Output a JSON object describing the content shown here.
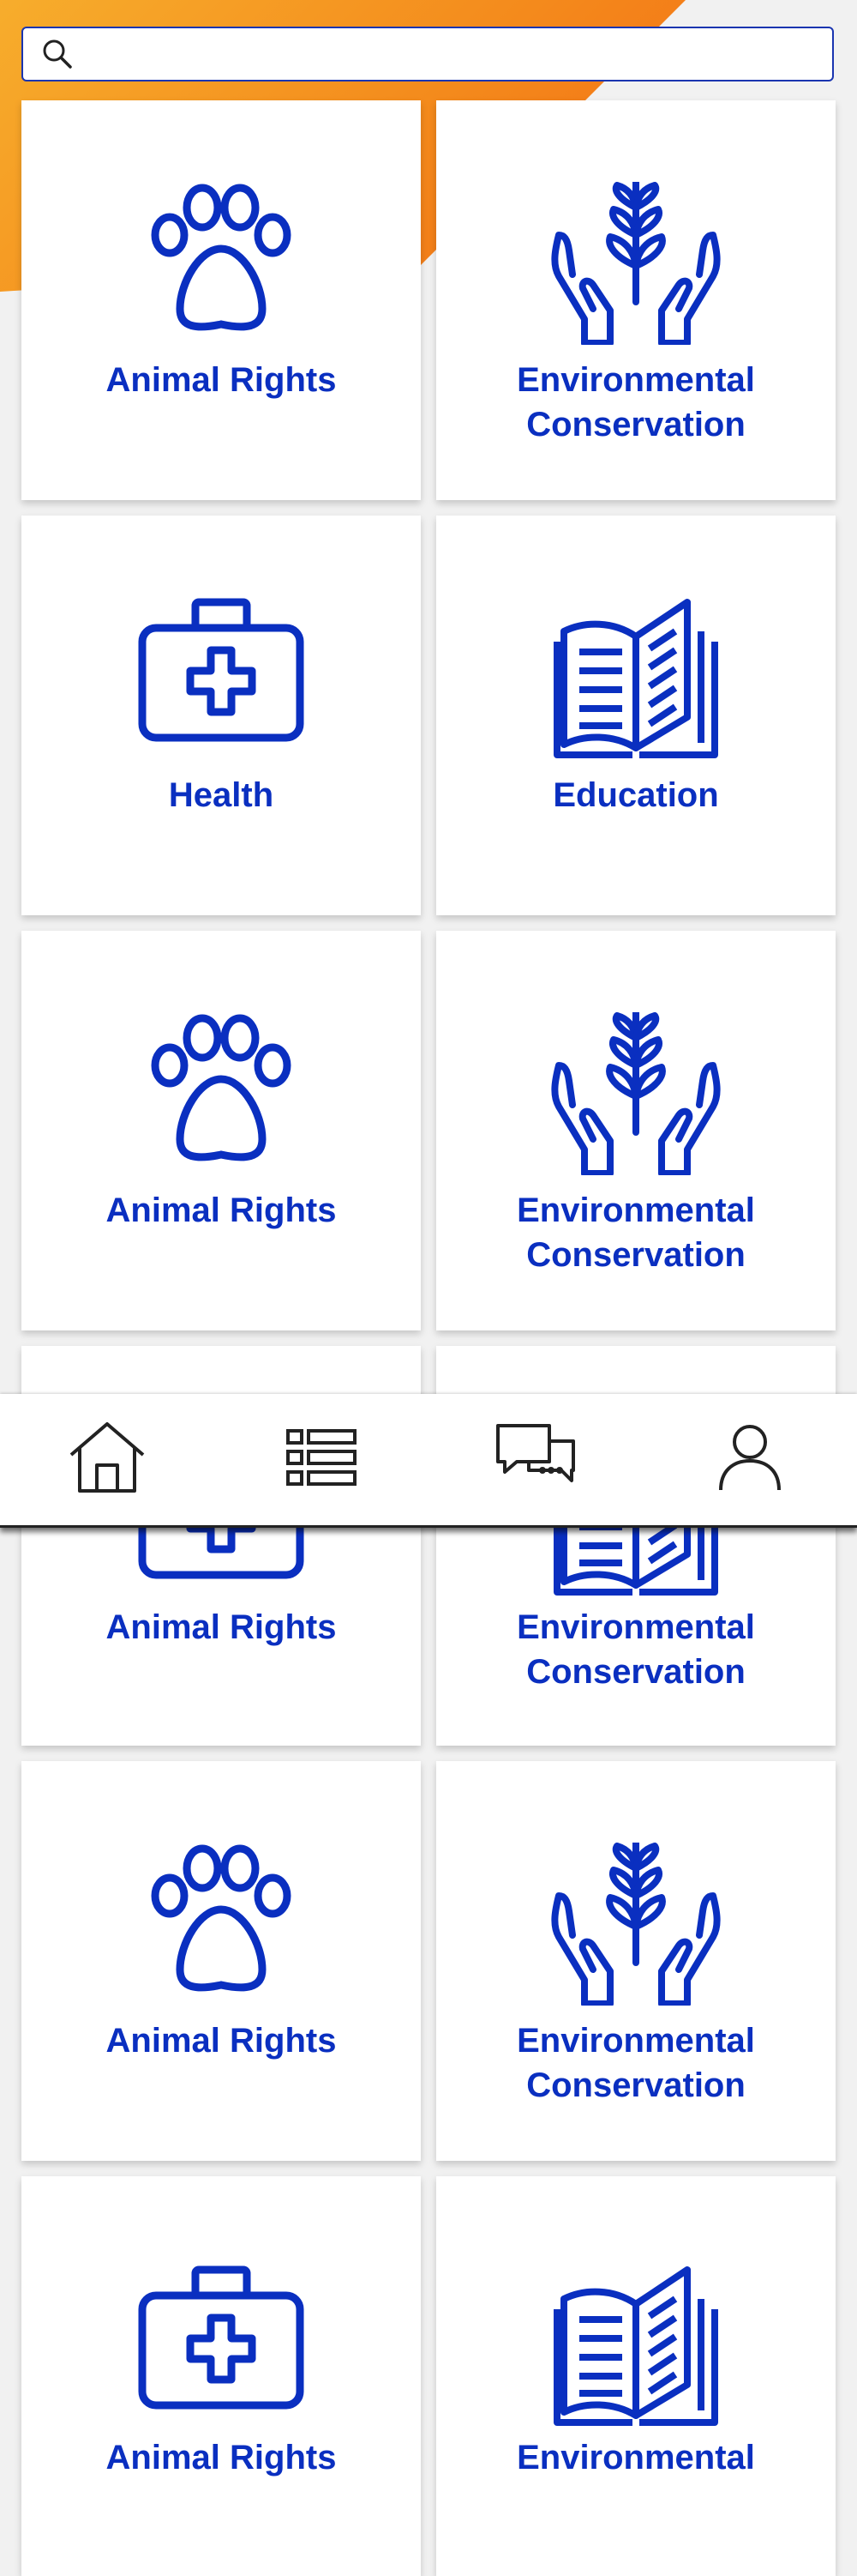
{
  "search": {
    "placeholder": "",
    "value": ""
  },
  "colors": {
    "accent": "#0a2fc0",
    "orange_start": "#f7ad2c",
    "orange_end": "#f26a12"
  },
  "cards": [
    {
      "label": "Animal Rights",
      "icon": "paw-icon"
    },
    {
      "label": "Environmental Conservation",
      "icon": "hands-plant-icon"
    },
    {
      "label": "Health",
      "icon": "first-aid-kit-icon"
    },
    {
      "label": "Education",
      "icon": "open-book-icon"
    },
    {
      "label": "Animal Rights",
      "icon": "paw-icon"
    },
    {
      "label": "Environmental Conservation",
      "icon": "hands-plant-icon"
    },
    {
      "label": "Animal Rights",
      "icon": "first-aid-kit-icon"
    },
    {
      "label": "Environmental Conservation",
      "icon": "open-book-icon"
    },
    {
      "label": "Animal Rights",
      "icon": "paw-icon"
    },
    {
      "label": "Environmental Conservation",
      "icon": "hands-plant-icon"
    },
    {
      "label": "Animal Rights",
      "icon": "first-aid-kit-icon"
    },
    {
      "label": "Environmental",
      "icon": "open-book-icon"
    }
  ],
  "nav": [
    {
      "icon": "home-icon"
    },
    {
      "icon": "list-icon"
    },
    {
      "icon": "chat-icon"
    },
    {
      "icon": "profile-icon"
    }
  ]
}
